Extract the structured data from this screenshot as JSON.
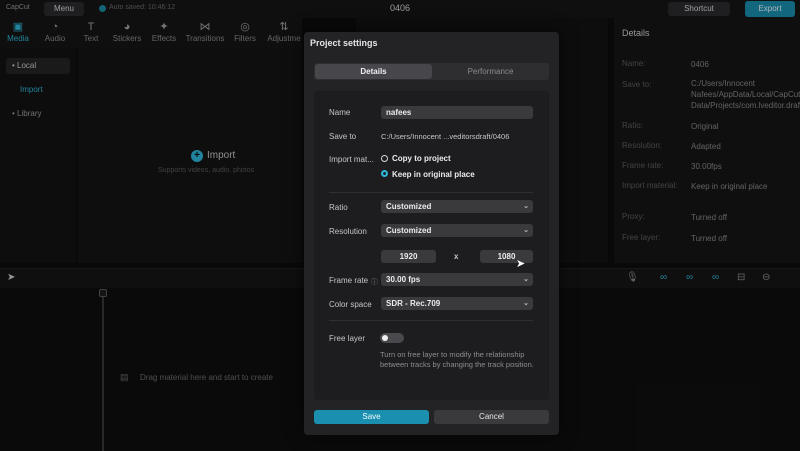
{
  "app": {
    "logo": "CapCut",
    "menu_label": "Menu",
    "autosave": "Auto saved: 10:46:12",
    "project_name": "0406",
    "shortcut_label": "Shortcut",
    "export_label": "Export",
    "accent_color": "#1a8fb0"
  },
  "tool_tabs": [
    {
      "label": "Media",
      "icon": "media-icon"
    },
    {
      "label": "Audio",
      "icon": "audio-icon"
    },
    {
      "label": "Text",
      "icon": "text-icon"
    },
    {
      "label": "Stickers",
      "icon": "stickers-icon"
    },
    {
      "label": "Effects",
      "icon": "effects-icon"
    },
    {
      "label": "Transitions",
      "icon": "transitions-icon"
    },
    {
      "label": "Filters",
      "icon": "filters-icon"
    },
    {
      "label": "Adjustme",
      "icon": "adjustment-icon"
    }
  ],
  "media_panel": {
    "local": "• Local",
    "import": "Import",
    "library": "• Library",
    "import_button": "Import",
    "import_hint": "Supports videos, audio, photos"
  },
  "details_panel": {
    "title": "Details",
    "rows": [
      {
        "key": "Name:",
        "value": "0406"
      },
      {
        "key": "Save to:",
        "value": "C:/Users/Innocent Nafees/AppData/Local/CapCut/User Data/Projects/com.lveditor.draft/0406"
      },
      {
        "key": "Ratio:",
        "value": "Original"
      },
      {
        "key": "Resolution:",
        "value": "Adapted"
      },
      {
        "key": "Frame rate:",
        "value": "30.00fps"
      },
      {
        "key": "Import material:",
        "value": "Keep in original place"
      },
      {
        "key": "Proxy:",
        "value": "Turned off"
      },
      {
        "key": "Free layer:",
        "value": "Turned off"
      }
    ]
  },
  "timeline": {
    "drag_hint": "Drag material here and start to create"
  },
  "dialog": {
    "title": "Project settings",
    "tabs": {
      "details": "Details",
      "performance": "Performance"
    },
    "name_label": "Name",
    "name_value": "nafees",
    "save_to_label": "Save to",
    "save_to_value": "C:/Users/Innocent ...veditorsdraft/0406",
    "import_label": "Import mat...",
    "import_options": {
      "copy": "Copy to project",
      "keep": "Keep in original place"
    },
    "import_selected": "keep",
    "ratio_label": "Ratio",
    "ratio_value": "Customized",
    "resolution_label": "Resolution",
    "resolution_value": "Customized",
    "width": "1920",
    "x_sep": "x",
    "height": "1080",
    "frame_rate_label": "Frame rate",
    "frame_rate_value": "30.00 fps",
    "color_space_label": "Color space",
    "color_space_value": "SDR - Rec.709",
    "free_layer_label": "Free layer",
    "free_layer_on": false,
    "free_layer_hint": "Turn on free layer to modify the relationship between tracks by changing the track position.",
    "save_label": "Save",
    "cancel_label": "Cancel"
  }
}
